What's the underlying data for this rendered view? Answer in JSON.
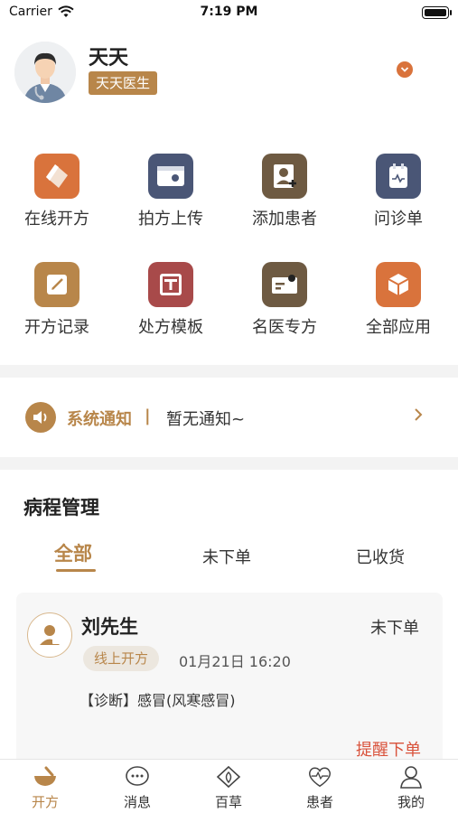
{
  "status_bar": {
    "carrier": "Carrier",
    "time": "7:19 PM"
  },
  "profile": {
    "name": "天天",
    "tag": "天天医生"
  },
  "apps": [
    {
      "label": "在线开方",
      "icon": "prescription-online-icon",
      "color": "#d9733c"
    },
    {
      "label": "拍方上传",
      "icon": "camera-upload-icon",
      "color": "#4a5676"
    },
    {
      "label": "添加患者",
      "icon": "add-patient-icon",
      "color": "#6e5a42"
    },
    {
      "label": "问诊单",
      "icon": "consult-form-icon",
      "color": "#4a5676"
    },
    {
      "label": "开方记录",
      "icon": "record-edit-icon",
      "color": "#b8864a"
    },
    {
      "label": "处方模板",
      "icon": "template-icon",
      "color": "#a84a4a"
    },
    {
      "label": "名医专方",
      "icon": "famous-doctor-card-icon",
      "color": "#6e5a42"
    },
    {
      "label": "全部应用",
      "icon": "all-apps-box-icon",
      "color": "#d9733c"
    }
  ],
  "notice": {
    "title": "系统通知",
    "separator": "|",
    "text": "暂无通知~"
  },
  "course": {
    "title": "病程管理",
    "tabs": [
      {
        "label": "全部",
        "active": true
      },
      {
        "label": "未下单",
        "active": false
      },
      {
        "label": "已收货",
        "active": false
      }
    ],
    "card": {
      "name": "刘先生",
      "status": "未下单",
      "tag": "线上开方",
      "time": "01月21日 16:20",
      "diagnosis": "【诊断】感冒(风寒感冒)",
      "action": "提醒下单"
    }
  },
  "tabbar": [
    {
      "label": "开方",
      "icon": "mortar-icon",
      "active": true
    },
    {
      "label": "消息",
      "icon": "message-icon",
      "active": false
    },
    {
      "label": "百草",
      "icon": "herb-leaf-icon",
      "active": false
    },
    {
      "label": "患者",
      "icon": "heartbeat-icon",
      "active": false
    },
    {
      "label": "我的",
      "icon": "profile-icon",
      "active": false
    }
  ],
  "colors": {
    "accent": "#b8864a",
    "alert": "#d9533c"
  }
}
